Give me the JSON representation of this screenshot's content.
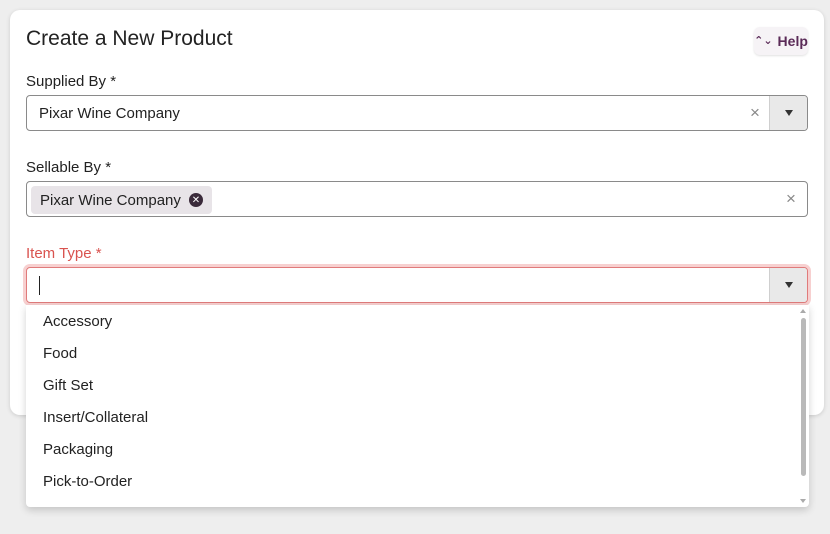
{
  "form": {
    "title": "Create a New Product",
    "help_label": "Help",
    "help_icon": "chevron-up-down-icon"
  },
  "supplied_by": {
    "label": "Supplied By *",
    "value": "Pixar Wine Company",
    "clear": "×"
  },
  "sellable_by": {
    "label": "Sellable By *",
    "chips": [
      "Pixar Wine Company"
    ],
    "chip_remove": "✕",
    "clear": "×"
  },
  "item_type": {
    "label": "Item Type *",
    "value": "",
    "error_color": "#d9534f",
    "options": [
      "Accessory",
      "Food",
      "Gift Set",
      "Insert/Collateral",
      "Packaging",
      "Pick-to-Order"
    ]
  },
  "colors": {
    "accent": "#5a2a57",
    "error": "#d9534f"
  }
}
